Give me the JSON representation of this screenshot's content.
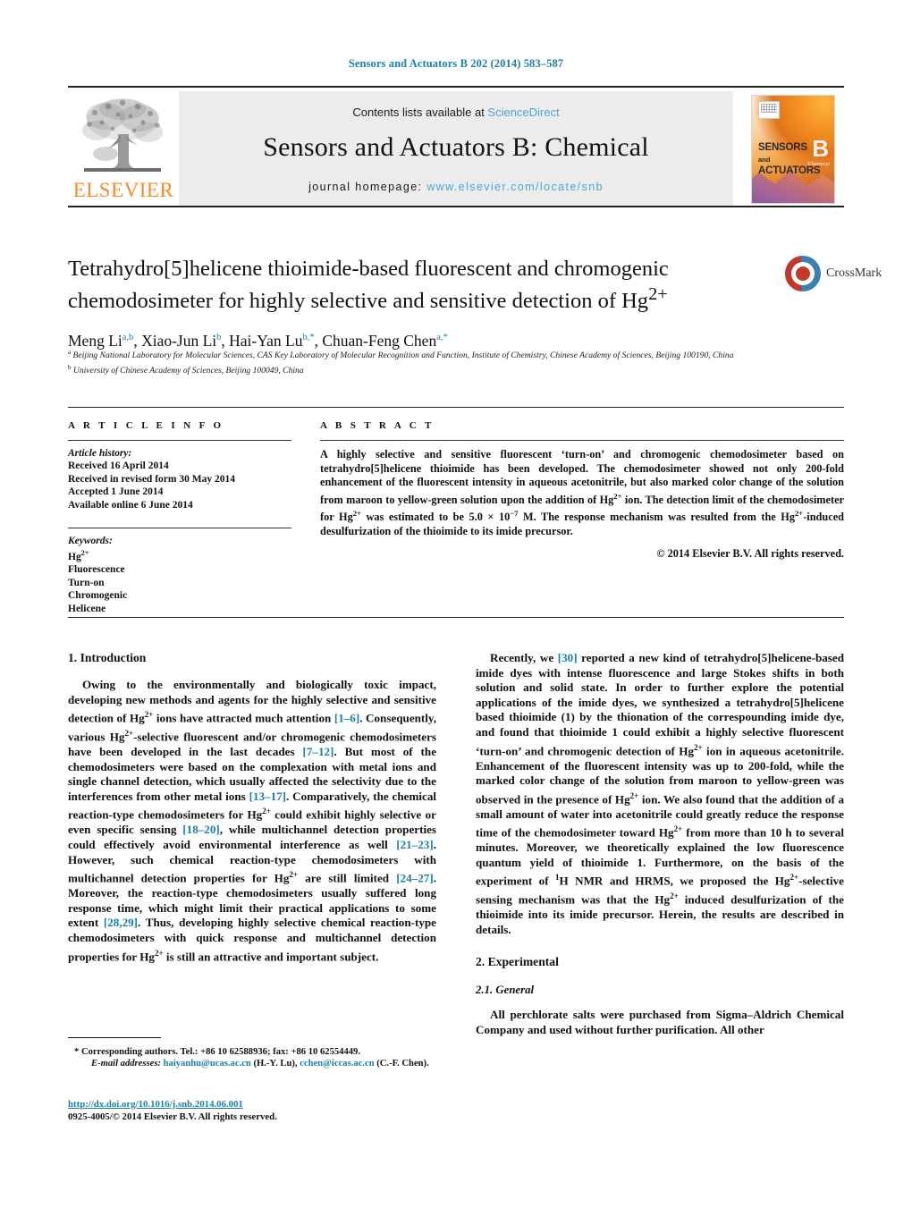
{
  "running_head": "Sensors and Actuators B 202 (2014) 583–587",
  "masthead": {
    "contents_prefix": "Contents lists available at ",
    "sciencedirect": "ScienceDirect",
    "journal_name": "Sensors and Actuators B: Chemical",
    "homepage_label": "journal homepage: ",
    "homepage_url": "www.elsevier.com/locate/snb",
    "publisher_logo_text": "ELSEVIER",
    "cover": {
      "line1": "SENSORS",
      "line1_small": "and",
      "line2": "ACTUATORS",
      "volume_letter": "B",
      "volume_sub": "Chemical"
    }
  },
  "article": {
    "title_line1": "Tetrahydro[5]helicene thioimide-based fluorescent and chromogenic",
    "title_line2_pre": "chemodosimeter for highly selective and sensitive detection of Hg",
    "title_line2_sup": "2+",
    "authors": [
      {
        "name": "Meng Li",
        "sup": "a,b",
        "sep": ", "
      },
      {
        "name": "Xiao-Jun Li",
        "sup": "b",
        "sep": ", "
      },
      {
        "name": "Hai-Yan Lu",
        "sup": "b,*",
        "sep": ", "
      },
      {
        "name": "Chuan-Feng Chen",
        "sup": "a,*",
        "sep": ""
      }
    ],
    "crossmark_label": "CrossMark",
    "affiliations": [
      {
        "marker": "a",
        "text": "Beijing National Laboratory for Molecular Sciences, CAS Key Laboratory of Molecular Recognition and Function, Institute of Chemistry, Chinese Academy of Sciences, Beijing 100190, China"
      },
      {
        "marker": "b",
        "text": "University of Chinese Academy of Sciences, Beijing 100049, China"
      }
    ]
  },
  "article_info": {
    "heading": "A R T I C L E    I N F O",
    "history_label": "Article history:",
    "history": [
      "Received 16 April 2014",
      "Received in revised form 30 May 2014",
      "Accepted 1 June 2014",
      "Available online 6 June 2014"
    ],
    "keywords_label": "Keywords:",
    "keywords": [
      {
        "text": "Hg",
        "sup": "2+"
      },
      {
        "text": "Fluorescence",
        "sup": ""
      },
      {
        "text": "Turn-on",
        "sup": ""
      },
      {
        "text": "Chromogenic",
        "sup": ""
      },
      {
        "text": "Helicene",
        "sup": ""
      }
    ]
  },
  "abstract": {
    "heading": "A B S T R A C T",
    "paragraph_parts": [
      {
        "t": "A highly selective and sensitive fluorescent ‘turn-on’ and chromogenic chemodosimeter based on tetrahydro[5]helicene thioimide has been developed. The chemodosimeter showed not only 200-fold enhancement of the fluorescent intensity in aqueous acetonitrile, but also marked color change of the solution from maroon to yellow-green solution upon the addition of Hg",
        "sup": "2+"
      },
      {
        "t": " ion. The detection limit of the chemodosimeter for Hg",
        "sup": "2+"
      },
      {
        "t": " was estimated to be 5.0 × 10",
        "sup": "−7"
      },
      {
        "t": " M. The response mechanism was resulted from the Hg",
        "sup": "2+"
      },
      {
        "t": "-induced desulfurization of the thioimide to its imide precursor.",
        "sup": ""
      }
    ],
    "copyright": "© 2014 Elsevier B.V. All rights reserved."
  },
  "sections": {
    "introduction_heading": "1.  Introduction",
    "experimental_heading": "2.  Experimental",
    "general_heading": "2.1.  General"
  },
  "body": {
    "intro_p1": [
      {
        "t": "Owing to the environmentally and biologically toxic impact, developing new methods and agents for the highly selective and sensitive detection of Hg"
      },
      {
        "sup": "2+"
      },
      {
        "t": " ions have attracted much attention "
      },
      {
        "ref": "[1–6]"
      },
      {
        "t": ". Consequently, various Hg"
      },
      {
        "sup": "2+"
      },
      {
        "t": "-selective fluorescent and/or chromogenic chemodosimeters have been developed in the last decades "
      },
      {
        "ref": "[7–12]"
      },
      {
        "t": ". But most of the chemodosimeters were based on the complexation with metal ions and single channel detection, which usually affected the selectivity due to the interferences from other metal ions "
      },
      {
        "ref": "[13–17]"
      },
      {
        "t": ". Comparatively, the chemical reaction-type chemodosimeters for Hg"
      },
      {
        "sup": "2+"
      },
      {
        "t": " could exhibit highly selective or even specific sensing "
      },
      {
        "ref": "[18–20]"
      },
      {
        "t": ", while multichannel detection properties could effectively avoid environmental interference as well "
      },
      {
        "ref": "[21–23]"
      },
      {
        "t": ". However, such chemical reaction-type chemodosimeters with multichannel detection properties for Hg"
      },
      {
        "sup": "2+"
      },
      {
        "t": " are still limited "
      },
      {
        "ref": "[24–27]"
      },
      {
        "t": ". Moreover, the reaction-type chemodosimeters usually suffered long response time, which might limit their practical applications to some extent "
      },
      {
        "ref": "[28,29]"
      },
      {
        "t": ". Thus, developing highly selective chemical reaction-type chemodosimeters with quick response and multichannel detection properties for Hg"
      },
      {
        "sup": "2+"
      },
      {
        "t": " is still an attractive and important subject."
      }
    ],
    "intro_p2": [
      {
        "t": "Recently, we "
      },
      {
        "ref": "[30]"
      },
      {
        "t": " reported a new kind of tetrahydro[5]helicene-based imide dyes with intense fluorescence and large Stokes shifts in both solution and solid state. In order to further explore the potential applications of the imide dyes, we synthesized a tetrahydro[5]helicene based thioimide (1) by the thionation of the correspounding imide dye, and found that thioimide 1 could exhibit a highly selective fluorescent ‘turn-on’ and chromogenic detection of Hg"
      },
      {
        "sup": "2+"
      },
      {
        "t": " ion in aqueous acetonitrile. Enhancement of the fluorescent intensity was up to 200-fold, while the marked color change of the solution from maroon to yellow-green was observed in the presence of Hg"
      },
      {
        "sup": "2+"
      },
      {
        "t": " ion. We also found that the addition of a small amount of water into acetonitrile could greatly reduce the response time of the chemodosimeter toward Hg"
      },
      {
        "sup": "2+"
      },
      {
        "t": " from more than 10 h to several minutes. Moreover, we theoretically explained the low fluorescence quantum yield of thioimide 1. Furthermore, on the basis of the experiment of "
      },
      {
        "sup": "1"
      },
      {
        "t": "H NMR and HRMS, we proposed the Hg"
      },
      {
        "sup": "2+"
      },
      {
        "t": "-selective sensing mechanism was that the Hg"
      },
      {
        "sup": "2+"
      },
      {
        "t": " induced desulfurization of the thioimide into its imide precursor. Herein, the results are described in details."
      }
    ],
    "experimental_p1": [
      {
        "t": "All perchlorate salts were purchased from Sigma–Aldrich Chemical Company and used without further purification. All other"
      }
    ]
  },
  "footer": {
    "corresponding_marker": "*",
    "corresponding_text": "Corresponding authors. Tel.: +86 10 62588936; fax: +86 10 62554449.",
    "email_label": "E-mail addresses:",
    "email1": "haiyanhu@ucas.ac.cn",
    "email1_owner": "(H.-Y. Lu),",
    "email2": "cchen@iccas.ac.cn",
    "email2_owner": "(C.-F. Chen).",
    "doi_url": "http://dx.doi.org/10.1016/j.snb.2014.06.001",
    "issn_line": "0925-4005/© 2014 Elsevier B.V. All rights reserved."
  },
  "colors": {
    "link_blue": "#1a7fa8",
    "sciencedirect_blue": "#4aa5d8",
    "elsevier_orange": "#f28c28"
  }
}
